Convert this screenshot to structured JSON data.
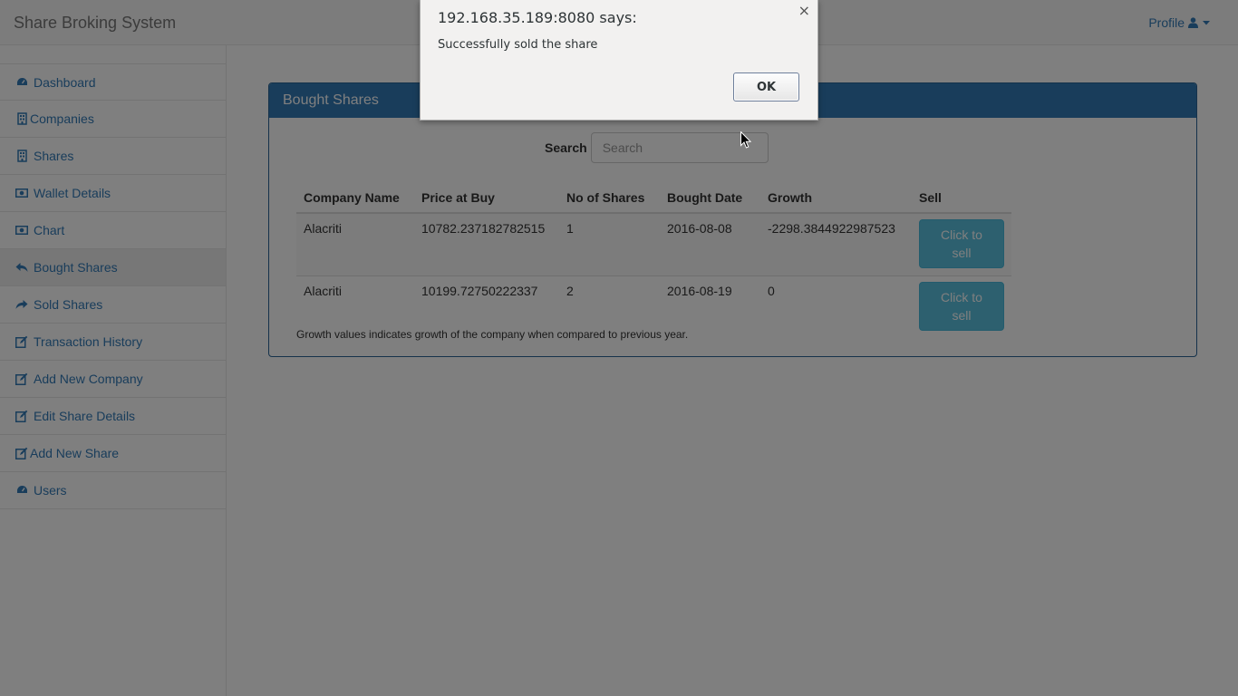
{
  "app": {
    "brand": "Share Broking System",
    "profile_label": "Profile"
  },
  "sidebar": {
    "items": [
      {
        "label": "Dashboard",
        "icon": "dashboard-icon"
      },
      {
        "label": "Companies",
        "icon": "building-icon"
      },
      {
        "label": "Shares",
        "icon": "building-icon"
      },
      {
        "label": "Wallet Details",
        "icon": "money-icon"
      },
      {
        "label": "Chart",
        "icon": "money-icon"
      },
      {
        "label": "Bought Shares",
        "icon": "reply-icon",
        "active": true
      },
      {
        "label": "Sold Shares",
        "icon": "share-icon"
      },
      {
        "label": "Transaction History",
        "icon": "edit-icon"
      },
      {
        "label": "Add New Company",
        "icon": "edit-icon"
      },
      {
        "label": "Edit Share Details",
        "icon": "edit-icon"
      },
      {
        "label": "Add New Share",
        "icon": "edit-icon"
      },
      {
        "label": "Users",
        "icon": "dashboard-icon"
      }
    ]
  },
  "panel": {
    "title": "Bought Shares",
    "search_label": "Search",
    "search_placeholder": "Search",
    "search_value": "",
    "columns": [
      "Company Name",
      "Price at Buy",
      "No of Shares",
      "Bought Date",
      "Growth",
      "Sell"
    ],
    "rows": [
      {
        "company": "Alacriti",
        "price": "10782.237182782515",
        "shares": "1",
        "date": "2016-08-08",
        "growth": "-2298.3844922987523",
        "action": "Click to sell"
      },
      {
        "company": "Alacriti",
        "price": "10199.72750222337",
        "shares": "2",
        "date": "2016-08-19",
        "growth": "0",
        "action": "Click to sell"
      }
    ],
    "note": "Growth values indicates growth of the company when compared to previous year."
  },
  "dialog": {
    "title": "192.168.35.189:8080 says:",
    "message": "Successfully sold the share",
    "ok_label": "OK",
    "close_glyph": "×"
  },
  "colors": {
    "primary": "#337ab7",
    "info_button": "#5bc0de",
    "overlay": "rgba(0,0,0,0.5)"
  }
}
